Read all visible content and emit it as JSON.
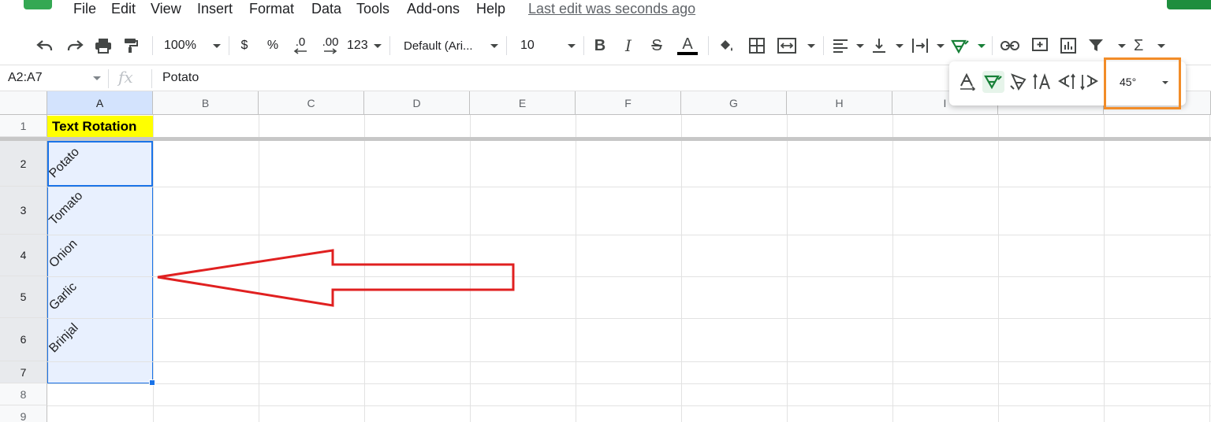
{
  "menu": {
    "items": [
      "File",
      "Edit",
      "View",
      "Insert",
      "Format",
      "Data",
      "Tools",
      "Add-ons",
      "Help"
    ],
    "last_edit": "Last edit was seconds ago"
  },
  "toolbar": {
    "zoom": "100%",
    "currency": "$",
    "percent": "%",
    "decrease_decimal": ".0",
    "increase_decimal": ".00",
    "more_formats": "123",
    "font": "Default (Ari...",
    "font_size": "10"
  },
  "formula_bar": {
    "name_box": "A2:A7",
    "fx": "fx",
    "value": "Potato"
  },
  "grid": {
    "columns": [
      "A",
      "B",
      "C",
      "D",
      "E",
      "F",
      "G",
      "H",
      "I"
    ],
    "rows": [
      "1",
      "2",
      "3",
      "4",
      "5",
      "6",
      "7",
      "8",
      "9"
    ],
    "header_cell": "Text Rotation",
    "items": [
      "Potato",
      "Tomato",
      "Onion",
      "Garlic",
      "Brinjal"
    ]
  },
  "rotation_popup": {
    "angle": "45°"
  },
  "colors": {
    "header_fill": "#ffff00",
    "selection": "#e8f0fe",
    "selection_border": "#1a73e8",
    "highlight_box": "#f28c28",
    "arrow": "#e02020",
    "active_green": "#188038"
  }
}
